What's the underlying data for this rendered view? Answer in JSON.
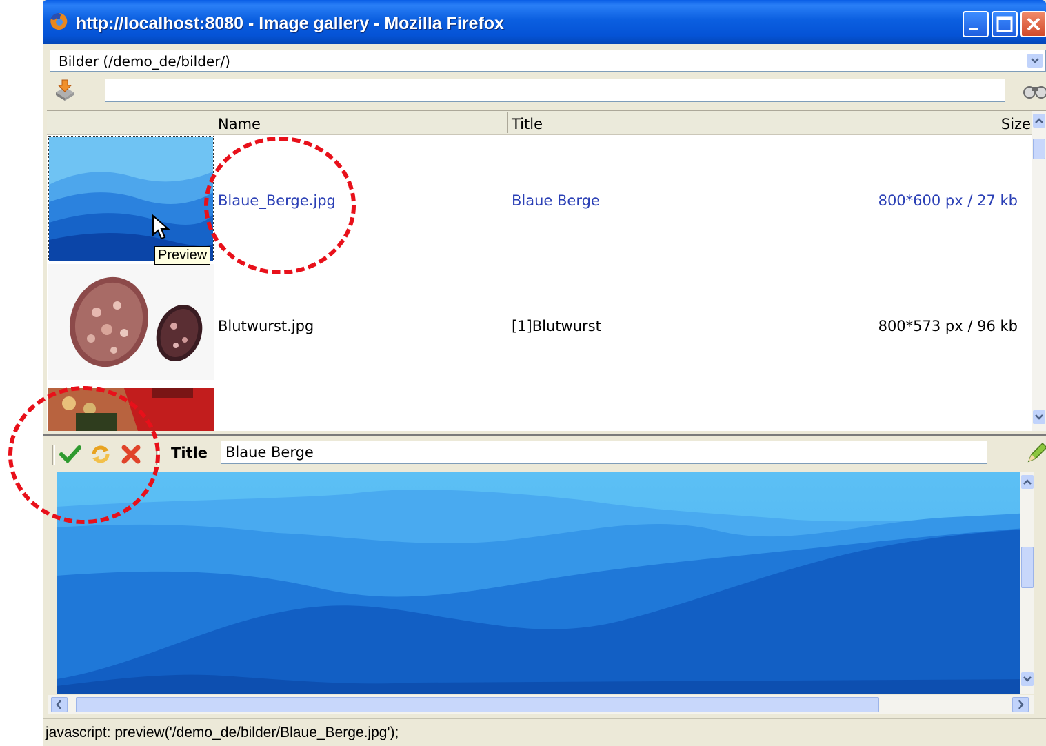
{
  "window": {
    "title": "http://localhost:8080 - Image gallery - Mozilla Firefox"
  },
  "folder_select": {
    "value": "Bilder (/demo_de/bilder/)"
  },
  "search": {
    "value": ""
  },
  "table": {
    "columns": [
      "Name",
      "Title",
      "Size"
    ],
    "rows": [
      {
        "name": "Blaue_Berge.jpg",
        "title": "Blaue Berge",
        "size": "800*600 px / 27 kb",
        "selected": true
      },
      {
        "name": "Blutwurst.jpg",
        "title": "[1]Blutwurst",
        "size": "800*573 px / 96 kb",
        "selected": false
      }
    ]
  },
  "tooltip": {
    "text": "Preview"
  },
  "edit_toolbar": {
    "title_label": "Title",
    "title_value": "Blaue Berge"
  },
  "status": {
    "text": "javascript: preview('/demo_de/bilder/Blaue_Berge.jpg');"
  },
  "colors": {
    "titlebar": "#0553d6",
    "annotation": "#e8101a",
    "selected_text": "#2a3fb5",
    "chrome": "#ece9d8"
  },
  "icons": {
    "app": "firefox-icon",
    "upload": "upload-icon",
    "search": "binoculars-icon",
    "save": "checkmark-icon",
    "reload": "refresh-icon",
    "delete": "delete-x-icon",
    "edit": "pencil-icon"
  }
}
